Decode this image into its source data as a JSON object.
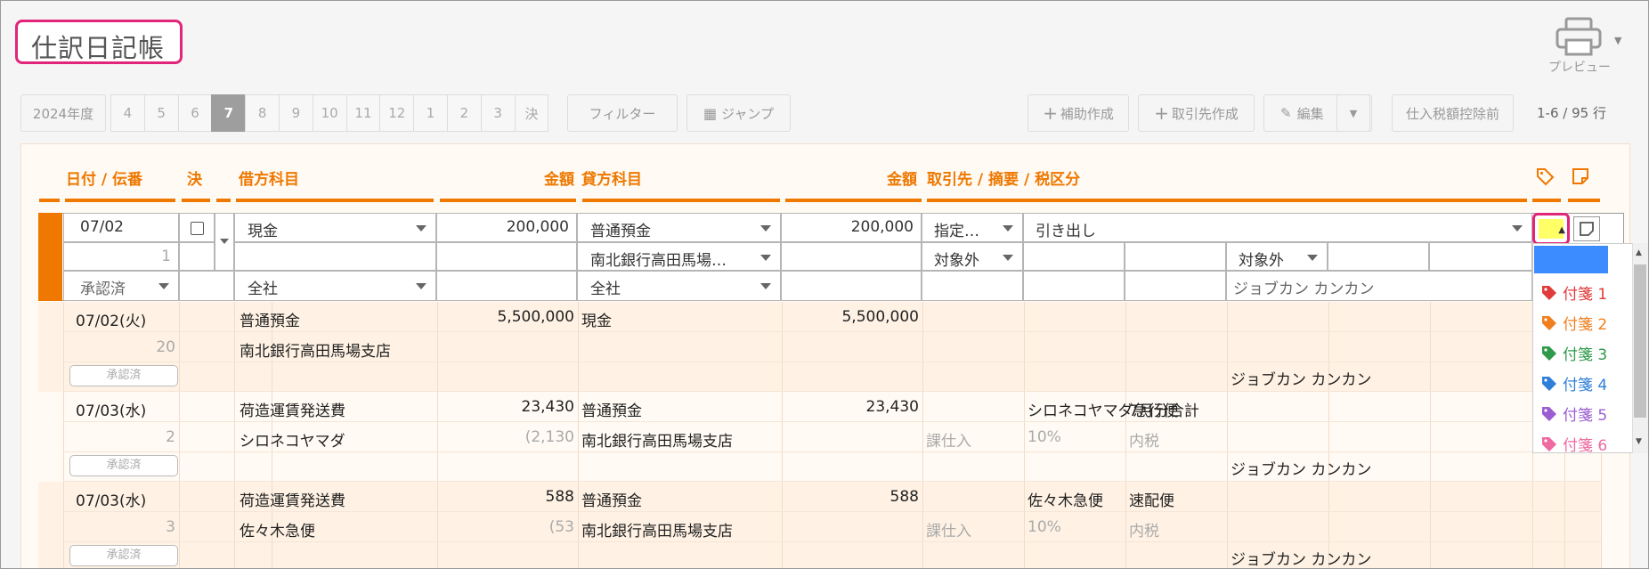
{
  "title": "仕訳日記帳",
  "preview_label": "プレビュー",
  "toolbar": {
    "year": "2024年度",
    "months": [
      "4",
      "5",
      "6",
      "7",
      "8",
      "9",
      "10",
      "11",
      "12",
      "1",
      "2",
      "3",
      "決"
    ],
    "active_month": "7",
    "filter": "フィルター",
    "jump": "ジャンプ",
    "sub_create": "補助作成",
    "client_create": "取引先作成",
    "edit": "編集",
    "deduct": "仕入税額控除前",
    "range": "1-6 / 95 行"
  },
  "headers": {
    "date": "日付 / 伝番",
    "settle": "決",
    "debit": "借方科目",
    "debit_amount": "金額",
    "credit": "貸方科目",
    "credit_amount": "金額",
    "client": "取引先 / 摘要 / 税区分"
  },
  "edit_row": {
    "date": "07/02",
    "number": "1",
    "status": "承認済",
    "debit_account": "現金",
    "debit_amount": "200,000",
    "debit_dept": "全社",
    "credit_account": "普通預金",
    "credit_sub": "南北銀行高田馬場…",
    "credit_amount": "200,000",
    "credit_dept": "全社",
    "client": "指定…",
    "summary": "引き出し",
    "tax1": "対象外",
    "tax2": "対象外",
    "user": "ジョブカン カンカン"
  },
  "rows": [
    {
      "date": "07/02(火)",
      "no": "20",
      "status": "承認済",
      "debit": "普通預金",
      "debit_sub": "南北銀行高田馬場支店",
      "debit_amount": "5,500,000",
      "debit_tax": "",
      "credit": "現金",
      "credit_sub": "",
      "credit_amount": "5,500,000",
      "client": "",
      "summary": "",
      "tax_cat": "",
      "tax_rate": "",
      "tax_type": "",
      "user": "ジョブカン カンカン"
    },
    {
      "date": "07/03(水)",
      "no": "2",
      "status": "承認済",
      "debit": "荷造運賃発送費",
      "debit_sub": "シロネコヤマダ",
      "debit_amount": "23,430",
      "debit_tax": "(2,130",
      "credit": "普通預金",
      "credit_sub": "南北銀行高田馬場支店",
      "credit_amount": "23,430",
      "client": "シロネコヤマダ急行便",
      "summary": "7月分合計",
      "tax_cat": "課仕入",
      "tax_rate": "10%",
      "tax_type": "内税",
      "user": "ジョブカン カンカン"
    },
    {
      "date": "07/03(水)",
      "no": "3",
      "status": "承認済",
      "debit": "荷造運賃発送費",
      "debit_sub": "佐々木急便",
      "debit_amount": "588",
      "debit_tax": "(53",
      "credit": "普通預金",
      "credit_sub": "南北銀行高田馬場支店",
      "credit_amount": "588",
      "client": "佐々木急便",
      "summary": "速配便",
      "tax_cat": "課仕入",
      "tax_rate": "10%",
      "tax_type": "内税",
      "user": "ジョブカン カンカン"
    }
  ],
  "tags": [
    {
      "label": "付箋 1",
      "color": "#e03a3a"
    },
    {
      "label": "付箋 2",
      "color": "#f07f1e"
    },
    {
      "label": "付箋 3",
      "color": "#2e9a4a"
    },
    {
      "label": "付箋 4",
      "color": "#2f7fd8"
    },
    {
      "label": "付箋 5",
      "color": "#9b5dd1"
    },
    {
      "label": "付箋 6",
      "color": "#ee6aa0"
    }
  ],
  "colors": {
    "accent": "#ee7800",
    "highlight": "#e0257a"
  }
}
